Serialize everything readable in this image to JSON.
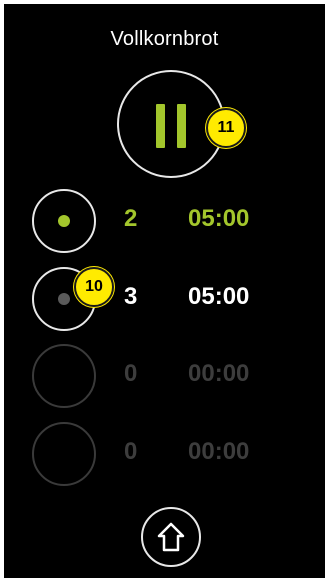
{
  "header": {
    "title": "Vollkornbrot"
  },
  "colors": {
    "accent": "#a3c62c",
    "active_text": "#a3c62c",
    "normal_text": "#ffffff",
    "dim_text": "#3d3d3d",
    "badge": "#ffeb00"
  },
  "controls": {
    "pause_icon": "pause-icon",
    "pause_badge": "11",
    "home_icon": "home-icon"
  },
  "stages": [
    {
      "count": "2",
      "time": "05:00",
      "state": "active"
    },
    {
      "count": "3",
      "time": "05:00",
      "state": "pending",
      "badge": "10"
    },
    {
      "count": "0",
      "time": "00:00",
      "state": "disabled"
    },
    {
      "count": "0",
      "time": "00:00",
      "state": "disabled"
    }
  ]
}
